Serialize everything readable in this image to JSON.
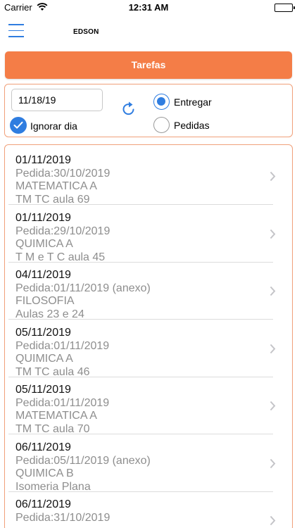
{
  "status_bar": {
    "carrier": "Carrier",
    "time": "12:31 AM"
  },
  "nav": {
    "title": "EDSON"
  },
  "header": {
    "title": "Tarefas",
    "color": "#f47d47"
  },
  "filters": {
    "date_value": "11/18/19",
    "ignore_day_label": "Ignorar dia",
    "ignore_day_checked": true,
    "options": [
      {
        "label": "Entregar",
        "selected": true
      },
      {
        "label": "Pedidas",
        "selected": false
      }
    ]
  },
  "colors": {
    "accent": "#2f7de0",
    "border": "#f0a07a",
    "secondary_text": "#8e8e8e"
  },
  "tasks": [
    {
      "date": "01/11/2019",
      "requested": "Pedida:30/10/2019",
      "subject": "MATEMATICA A",
      "description": "TM TC aula 69"
    },
    {
      "date": "01/11/2019",
      "requested": "Pedida:29/10/2019",
      "subject": "QUIMICA A",
      "description": "T M e T C aula 45"
    },
    {
      "date": "04/11/2019",
      "requested": "Pedida:01/11/2019 (anexo)",
      "subject": "FILOSOFIA",
      "description": "Aulas 23 e 24"
    },
    {
      "date": "05/11/2019",
      "requested": "Pedida:01/11/2019",
      "subject": "QUIMICA A",
      "description": "TM TC aula 46"
    },
    {
      "date": "05/11/2019",
      "requested": "Pedida:01/11/2019",
      "subject": "MATEMATICA A",
      "description": "TM TC aula 70"
    },
    {
      "date": "06/11/2019",
      "requested": "Pedida:05/11/2019 (anexo)",
      "subject": "QUIMICA B",
      "description": "Isomeria Plana"
    },
    {
      "date": "06/11/2019",
      "requested": "Pedida:31/10/2019",
      "subject": "",
      "description": ""
    }
  ]
}
